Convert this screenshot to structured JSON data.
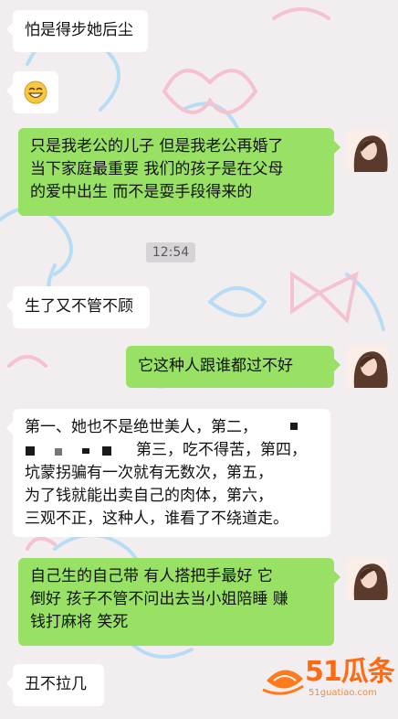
{
  "messages": [
    {
      "side": "in",
      "lines": [
        "怕是得步她后尘"
      ]
    },
    {
      "side": "in",
      "emoji": "grinning-face-emoji"
    },
    {
      "side": "out",
      "lines": [
        "只是我老公的儿子 但是我老公再婚了",
        "当下家庭最重要 我们的孩子是在父母",
        "的爱中出生 而不是耍手段得来的"
      ]
    },
    {
      "side": "in",
      "lines": [
        "生了又不管不顾"
      ]
    },
    {
      "side": "out",
      "lines": [
        "它这种人跟谁都过不好"
      ]
    },
    {
      "side": "in",
      "lines": [
        "第一、她也不是绝世美人，第二，",
        "第三，吃不得苦，第四，",
        "坑蒙拐骗有一次就有无数次，第五，",
        "为了钱就能出卖自己的肉体，第六，",
        "三观不正，这种人，谁看了不绕道走。"
      ]
    },
    {
      "side": "out",
      "lines": [
        "自己生的自己带 有人搭把手最好 它",
        "倒好 孩子不管不问出去当小姐陪睡 赚",
        "钱打麻将 笑死"
      ]
    },
    {
      "side": "in",
      "lines": [
        "丑不拉几"
      ]
    }
  ],
  "timestamp": "12:54",
  "watermark": {
    "brand": "51瓜条",
    "url": "51guatiao.com"
  },
  "colors": {
    "outgoing": "#98e165",
    "incoming": "#ffffff",
    "watermark": "#ff6a13"
  }
}
